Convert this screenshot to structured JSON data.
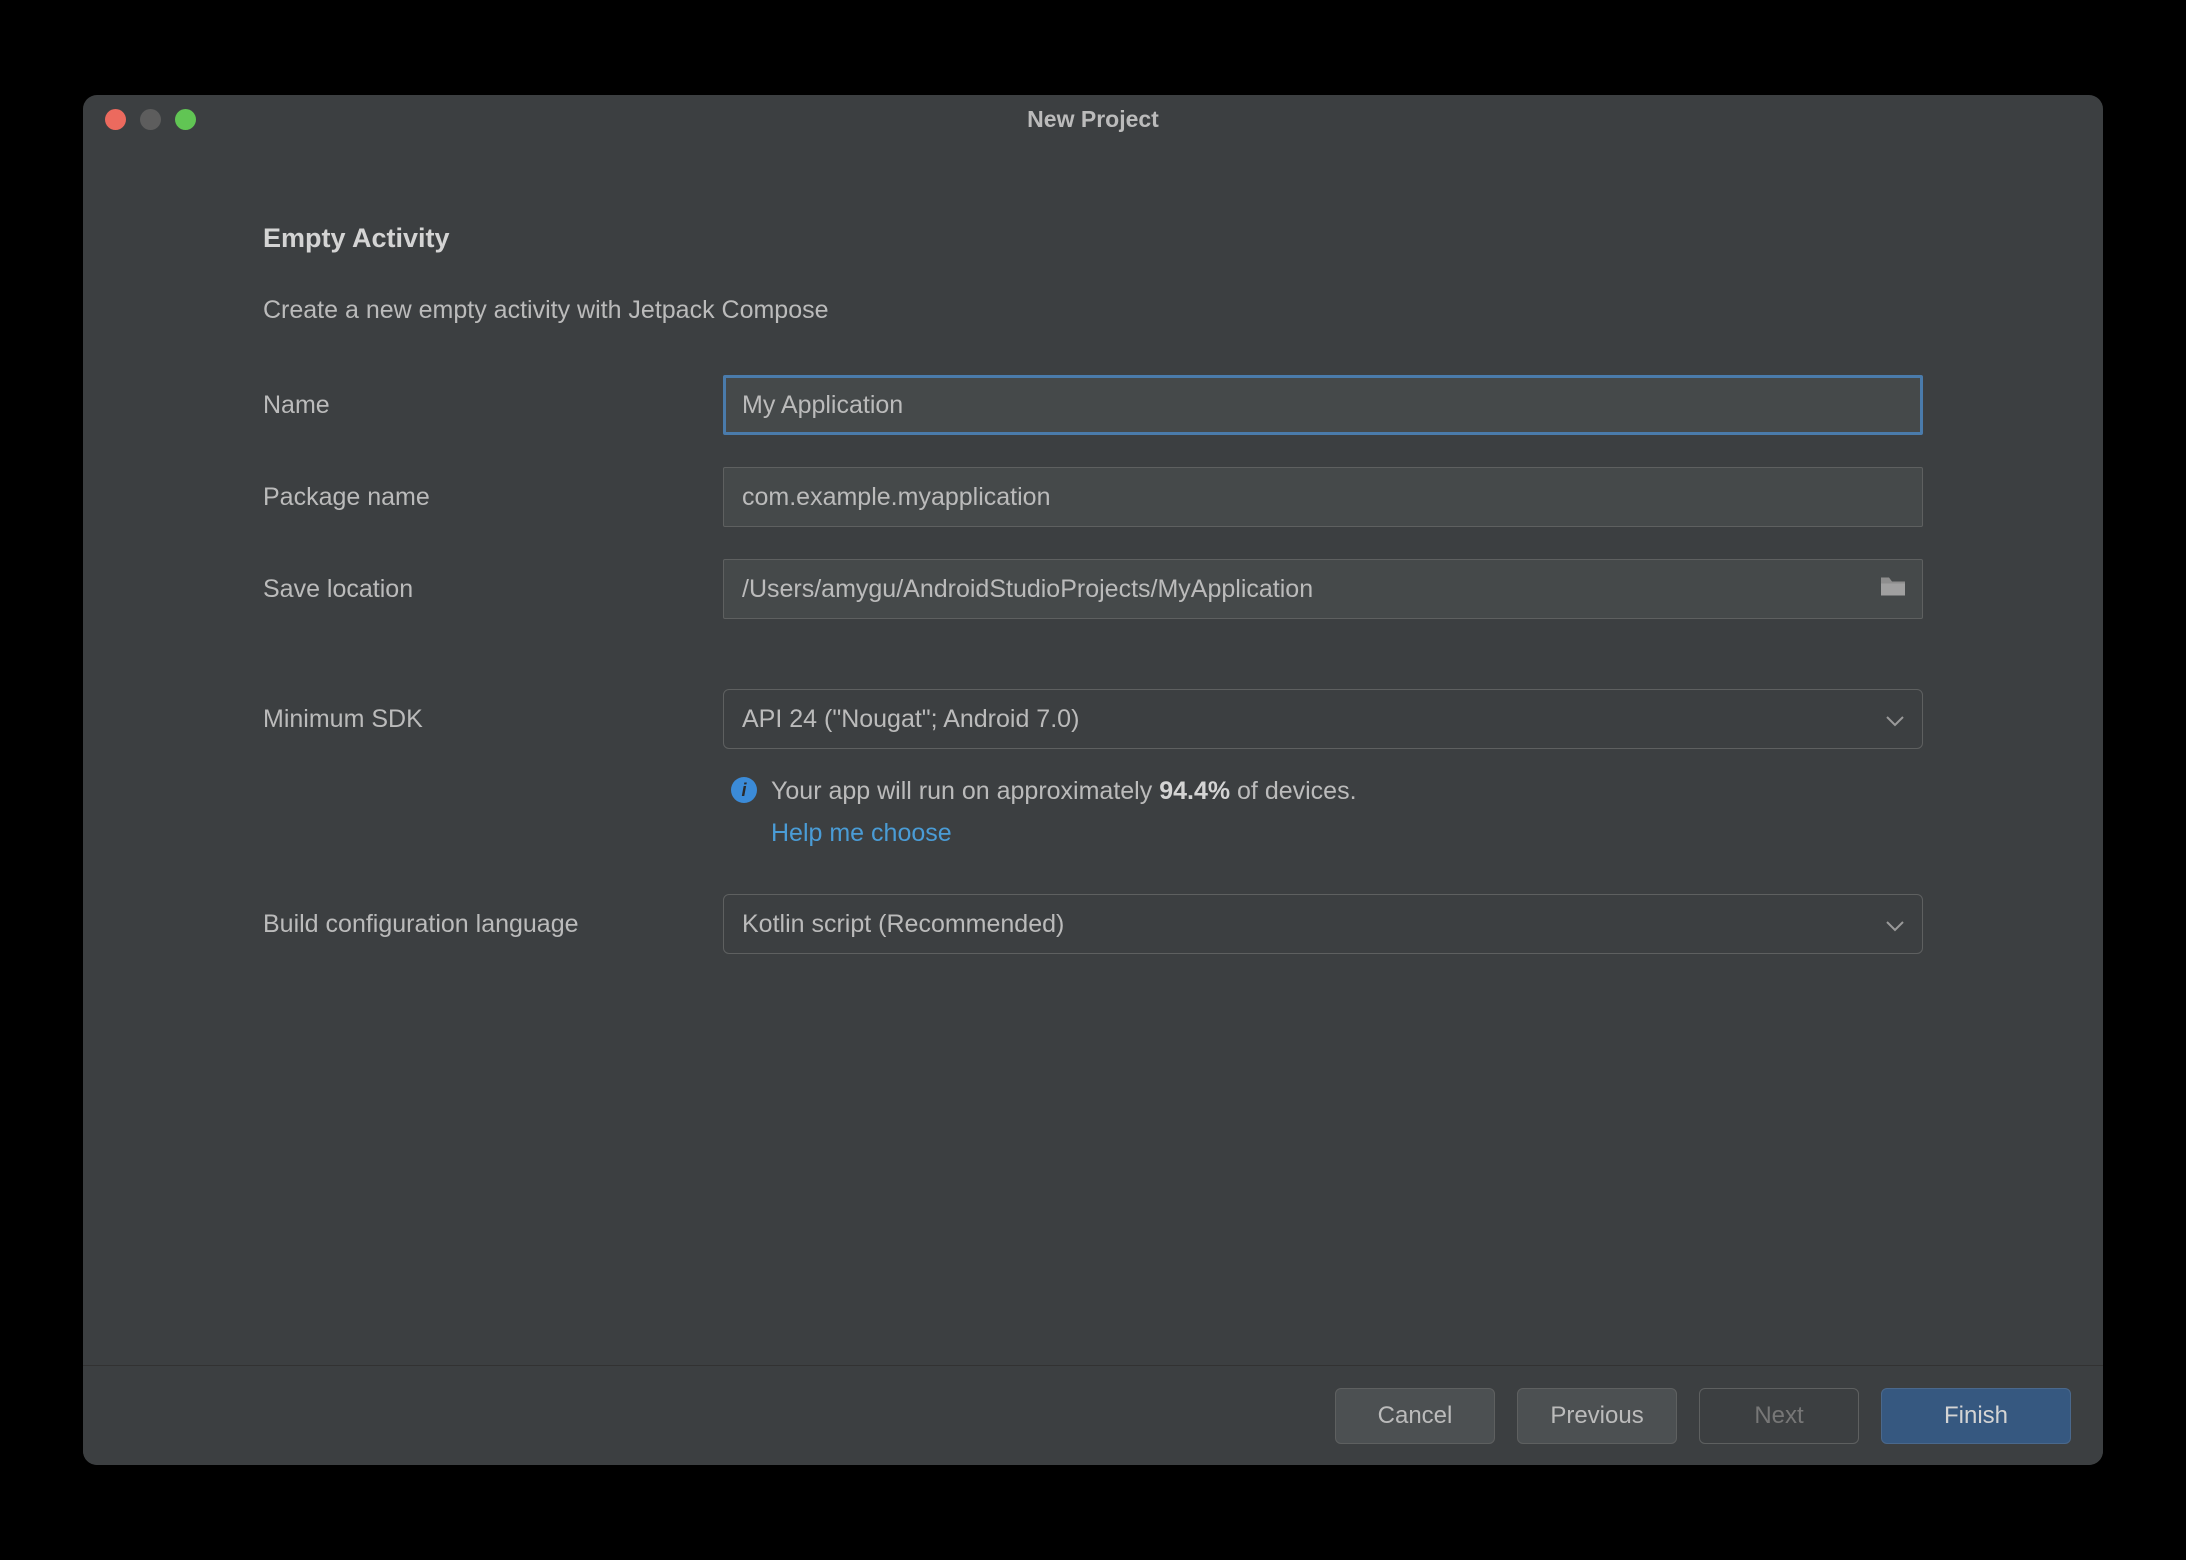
{
  "window": {
    "title": "New Project"
  },
  "content": {
    "heading": "Empty Activity",
    "subheading": "Create a new empty activity with Jetpack Compose"
  },
  "form": {
    "name_label": "Name",
    "name_value": "My Application",
    "package_label": "Package name",
    "package_value": "com.example.myapplication",
    "save_label": "Save location",
    "save_value": "/Users/amygu/AndroidStudioProjects/MyApplication",
    "minsdk_label": "Minimum SDK",
    "minsdk_value": "API 24 (\"Nougat\"; Android 7.0)",
    "buildlang_label": "Build configuration language",
    "buildlang_value": "Kotlin script (Recommended)"
  },
  "info": {
    "prefix": "Your app will run on approximately ",
    "pct": "94.4%",
    "suffix": " of devices.",
    "link": "Help me choose"
  },
  "buttons": {
    "cancel": "Cancel",
    "previous": "Previous",
    "next": "Next",
    "finish": "Finish"
  }
}
